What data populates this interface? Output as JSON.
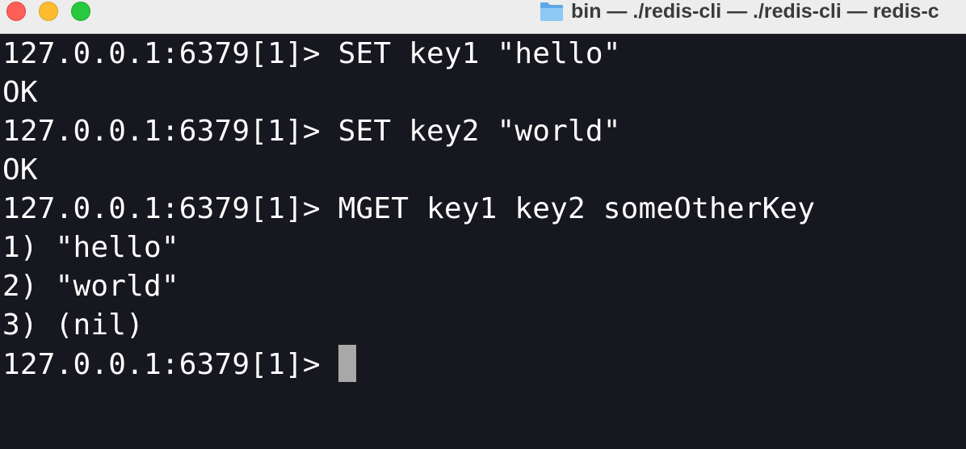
{
  "window": {
    "title": "bin — ./redis-cli — ./redis-cli — redis-c",
    "title_icon": "folder-icon",
    "traffic_lights": {
      "close_color": "#fe5f57",
      "minimize_color": "#febc2e",
      "maximize_color": "#28c840"
    }
  },
  "terminal": {
    "background": "#17181f",
    "foreground": "#ffffff",
    "prompt": "127.0.0.1:6379[1]> ",
    "lines": [
      {
        "kind": "command",
        "text": "SET key1 \"hello\""
      },
      {
        "kind": "output",
        "text": "OK"
      },
      {
        "kind": "command",
        "text": "SET key2 \"world\""
      },
      {
        "kind": "output",
        "text": "OK"
      },
      {
        "kind": "command",
        "text": "MGET key1 key2 someOtherKey"
      },
      {
        "kind": "output",
        "text": "1) \"hello\""
      },
      {
        "kind": "output",
        "text": "2) \"world\""
      },
      {
        "kind": "output",
        "text": "3) (nil)"
      }
    ],
    "current_input": ""
  }
}
